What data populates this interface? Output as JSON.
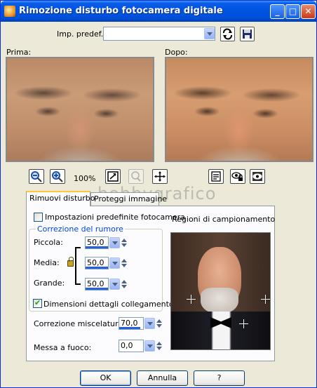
{
  "window": {
    "title": "Rimozione disturbo fotocamera digitale",
    "minimize_glyph": "_",
    "maximize_glyph": "□",
    "close_glyph": "✕"
  },
  "preset": {
    "label": "Imp. predef.:",
    "value": ""
  },
  "previews": {
    "before_label": "Prima:",
    "after_label": "Dopo:",
    "zoom_level": "100%"
  },
  "tabs": [
    {
      "label": "Rimuovi disturbo",
      "active": true
    },
    {
      "label": "Proteggi immagine",
      "active": false
    }
  ],
  "watermark": "hobbygrafico",
  "noise": {
    "camera_defaults_label": "Impostazioni predefinite fotocamera",
    "camera_defaults_checked": false,
    "group_title": "Correzione del rumore",
    "small_label": "Piccola:",
    "small_value": "50,0",
    "medium_label": "Media:",
    "medium_value": "50,0",
    "large_label": "Grande:",
    "large_value": "50,0",
    "link_details_label": "Dimensioni dettagli collegamento",
    "link_details_checked": true,
    "blend_label": "Correzione miscelatura:",
    "blend_value": "70,0",
    "sharpen_label": "Messa a fuoco:",
    "sharpen_value": "0,0",
    "sampling_label": "Regioni di campionamento"
  },
  "buttons": {
    "ok": "OK",
    "cancel": "Annulla",
    "help": "?"
  },
  "icons": {
    "title": "paint-program-icon",
    "zoom_out": "zoom-out-icon",
    "zoom_in": "zoom-in-icon",
    "fit": "zoom-fit-icon",
    "pan": "pan-icon",
    "move": "move-icon"
  }
}
